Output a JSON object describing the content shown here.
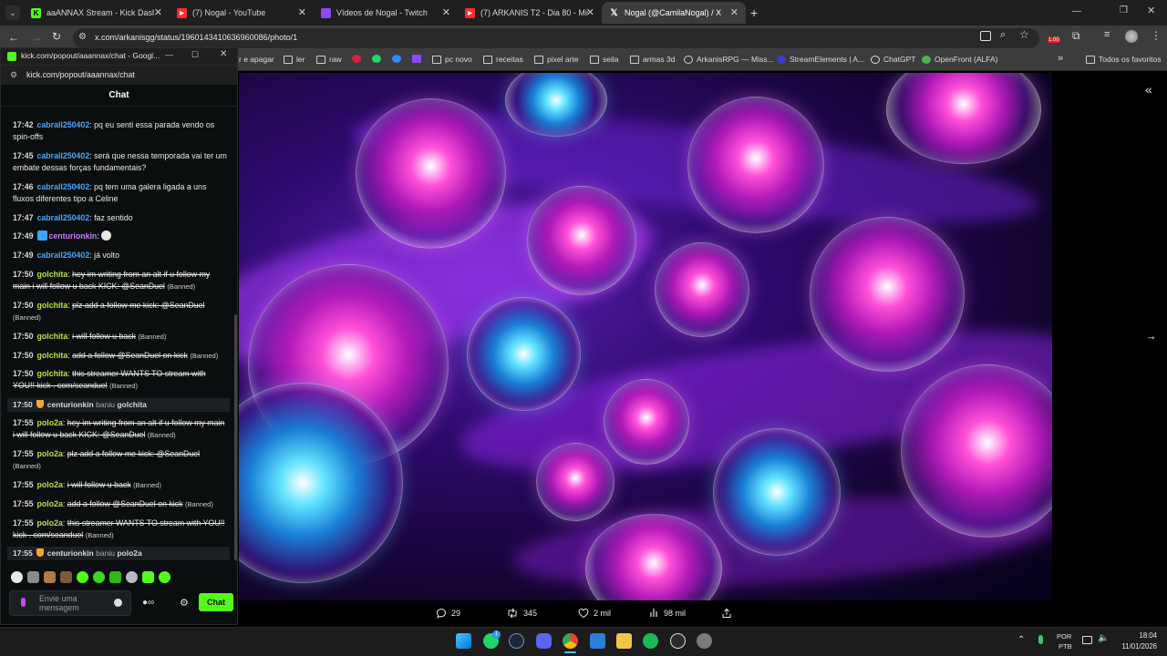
{
  "browser": {
    "tabs": [
      {
        "label": "aaANNAX Stream - Kick Dashbo",
        "favicon": "kick-icon",
        "active": false
      },
      {
        "label": "(7) Nogal - YouTube",
        "favicon": "youtube-icon",
        "active": false
      },
      {
        "label": "Vídeos de Nogal - Twitch",
        "favicon": "twitch-icon",
        "active": false
      },
      {
        "label": "(7) ARKANIS T2 - Dia 80 - Missi",
        "favicon": "youtube-icon",
        "active": false
      },
      {
        "label": "Nogal (@CamilaNogal) / X",
        "favicon": "x-icon",
        "active": true
      }
    ],
    "new_tab": "+",
    "url": "x.com/arkanisgg/status/1960143410636960086/photo/1",
    "bookmarks": [
      {
        "label": "r e apagar",
        "icon": "folder-icon"
      },
      {
        "label": "ler",
        "icon": "folder-icon"
      },
      {
        "label": "raw",
        "icon": "folder-icon"
      },
      {
        "label": "",
        "icon": "red-circle-icon"
      },
      {
        "label": "",
        "icon": "whatsapp-icon"
      },
      {
        "label": "",
        "icon": "messenger-icon"
      },
      {
        "label": "",
        "icon": "twitch-icon"
      },
      {
        "label": "pc novo",
        "icon": "folder-icon"
      },
      {
        "label": "receitas",
        "icon": "folder-icon"
      },
      {
        "label": "pixel arte",
        "icon": "folder-icon"
      },
      {
        "label": "seila",
        "icon": "folder-icon"
      },
      {
        "label": "armas 3d",
        "icon": "folder-icon"
      },
      {
        "label": "ArkanisRPG — Miss...",
        "icon": "globe-icon"
      },
      {
        "label": "StreamElements | A...",
        "icon": "streamelements-icon"
      },
      {
        "label": "ChatGPT",
        "icon": "chatgpt-icon"
      },
      {
        "label": "OpenFront (ALFA)",
        "icon": "openfront-icon"
      }
    ],
    "more_bookmarks": "»",
    "all_favorites": "Todos os favoritos",
    "extension_badge": "1.00"
  },
  "popup": {
    "title": "kick.com/popout/aaannax/chat - Googl...",
    "url": "kick.com/popout/aaannax/chat",
    "chat_header": "Chat",
    "messages": [
      {
        "time": "17:42",
        "user": "cabrall250402",
        "color": "blue",
        "text": "pq eu senti essa parada vendo os spin-offs",
        "banned": false
      },
      {
        "time": "17:45",
        "user": "cabrall250402",
        "color": "blue",
        "text": "será que nessa temporada vai ter um embate dessas forças fundamentais?",
        "banned": false
      },
      {
        "time": "17:46",
        "user": "cabrall250402",
        "color": "blue",
        "text": "pq tem uma galera ligada a uns fluxos diferentes tipo a Celine",
        "banned": false
      },
      {
        "time": "17:47",
        "user": "cabrall250402",
        "color": "blue",
        "text": "faz sentido",
        "banned": false
      },
      {
        "time": "17:49",
        "user": "centurionkin",
        "color": "purple",
        "text": "",
        "banned": false
      },
      {
        "time": "17:49",
        "user": "cabrall250402",
        "color": "blue",
        "text": "já volto",
        "banned": false
      },
      {
        "time": "17:50",
        "user": "golchita",
        "color": "green",
        "text": "hey im writing from an alt if u follow my main i will follow u back KICK: @SeanDuel",
        "banned": true
      },
      {
        "time": "17:50",
        "user": "golchita",
        "color": "green",
        "text": "plz add a follow me kick: @SeanDuel",
        "banned": true
      },
      {
        "time": "17:50",
        "user": "golchita",
        "color": "green",
        "text": "i will follow u back",
        "banned": true
      },
      {
        "time": "17:50",
        "user": "golchita",
        "color": "green",
        "text": "add a follow @SeanDuel on kick",
        "banned": true
      },
      {
        "time": "17:50",
        "user": "golchita",
        "color": "green",
        "text": "this streamer WANTS TO stream with YOU!! kick . com/seanduel",
        "banned": true
      },
      {
        "time": "17:55",
        "user": "polo2a",
        "color": "green",
        "text": "hey im writing from an alt if u follow my main i will follow u back KICK: @SeanDuel",
        "banned": true
      },
      {
        "time": "17:55",
        "user": "polo2a",
        "color": "green",
        "text": "plz add a follow me kick: @SeanDuel",
        "banned": true
      },
      {
        "time": "17:55",
        "user": "polo2a",
        "color": "green",
        "text": "i will follow u back",
        "banned": true
      },
      {
        "time": "17:55",
        "user": "polo2a",
        "color": "green",
        "text": "add a follow @SeanDuel on kick",
        "banned": true
      },
      {
        "time": "17:55",
        "user": "polo2a",
        "color": "green",
        "text": "this streamer WANTS TO stream with YOU!! kick . com/seanduel",
        "banned": true
      }
    ],
    "mod_actions": [
      {
        "time": "17:50",
        "mod": "centurionkin",
        "action": "baniu",
        "target": "golchita"
      },
      {
        "time": "17:55",
        "mod": "centurionkin",
        "action": "baniu",
        "target": "polo2a"
      }
    ],
    "banned_label": "(Banned)",
    "input_placeholder": "Envie uma mensagem",
    "send_label": "Chat"
  },
  "post": {
    "replies": "29",
    "reposts": "345",
    "likes": "2 mil",
    "views": "98 mil"
  },
  "taskbar": {
    "lang_top": "POR",
    "lang_bottom": "PTB",
    "time": "18:04",
    "date": "11/01/2026",
    "whatsapp_badge": "1"
  },
  "colors": {
    "kick_green": "#53fc18",
    "user_blue": "#4aa6ff",
    "user_green": "#b5e34a",
    "user_purple": "#c77dff"
  }
}
